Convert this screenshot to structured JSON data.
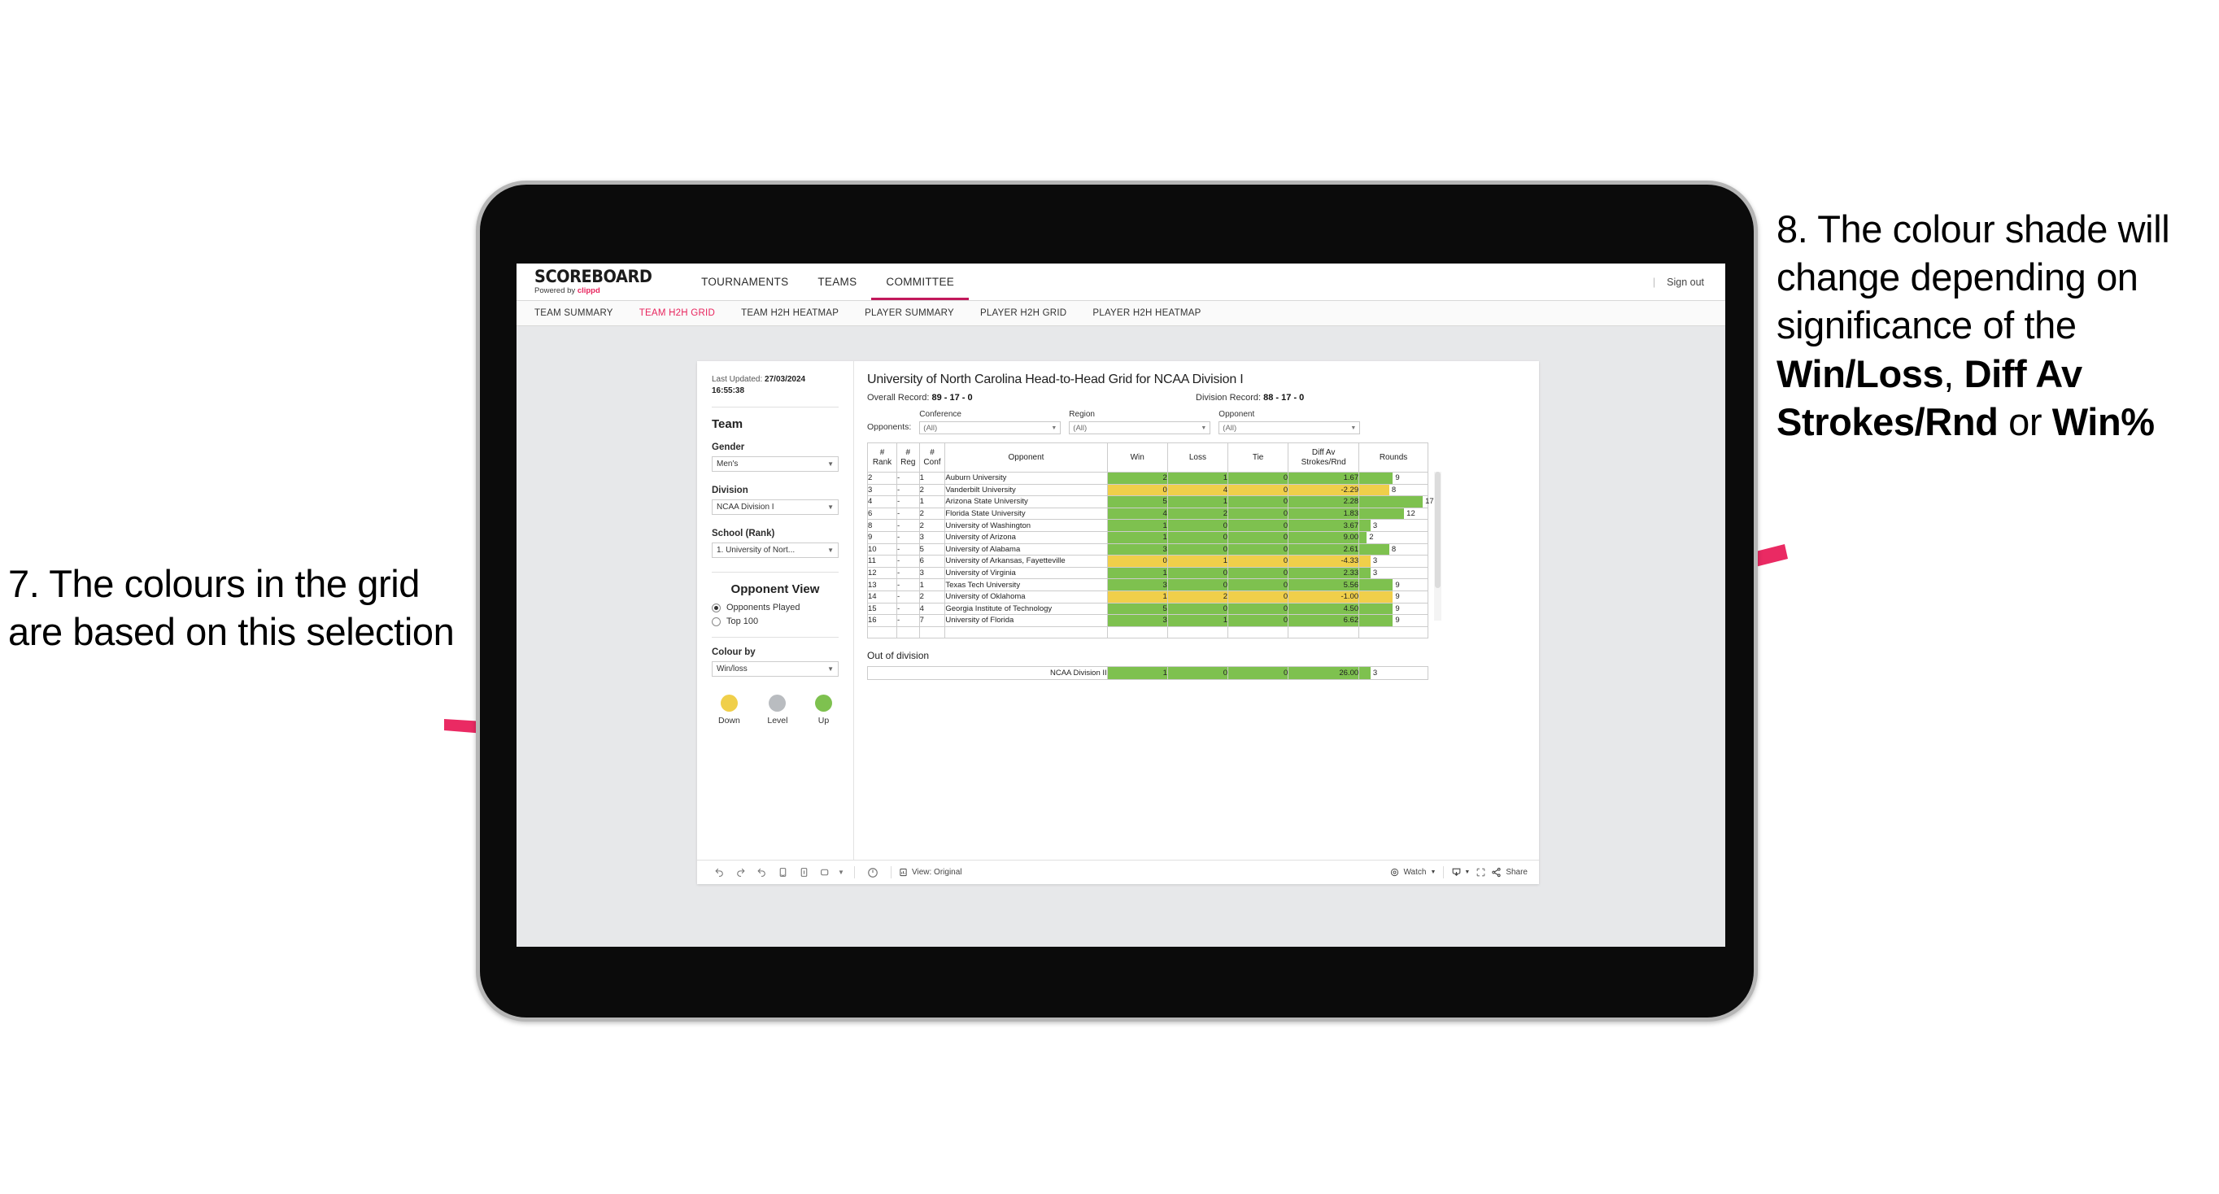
{
  "annotations": {
    "left": "7. The colours in the grid are based on this selection",
    "right_prefix": "8. The colour shade will change depending on significance of the ",
    "right_bold_1": "Win/Loss",
    "right_mid_1": ", ",
    "right_bold_2": "Diff Av Strokes/Rnd",
    "right_mid_2": " or ",
    "right_bold_3": "Win%",
    "arrow_color": "#ea2a63"
  },
  "app": {
    "brand": {
      "title": "SCOREBOARD",
      "powered_prefix": "Powered by ",
      "powered_brand": "clippd"
    },
    "topnav": [
      {
        "label": "TOURNAMENTS",
        "active": false
      },
      {
        "label": "TEAMS",
        "active": false
      },
      {
        "label": "COMMITTEE",
        "active": true
      }
    ],
    "signout": {
      "divider": "|",
      "label": "Sign out"
    },
    "subnav": [
      {
        "label": "TEAM SUMMARY",
        "active": false
      },
      {
        "label": "TEAM H2H GRID",
        "active": true
      },
      {
        "label": "TEAM H2H HEATMAP",
        "active": false
      },
      {
        "label": "PLAYER SUMMARY",
        "active": false
      },
      {
        "label": "PLAYER H2H GRID",
        "active": false
      },
      {
        "label": "PLAYER H2H HEATMAP",
        "active": false
      }
    ]
  },
  "filters": {
    "last_updated_label": "Last Updated: ",
    "last_updated_value": "27/03/2024 16:55:38",
    "team_heading": "Team",
    "gender": {
      "label": "Gender",
      "value": "Men's"
    },
    "division": {
      "label": "Division",
      "value": "NCAA Division I"
    },
    "school": {
      "label": "School (Rank)",
      "value": "1. University of Nort..."
    },
    "opponent_view": {
      "heading": "Opponent View",
      "options": [
        {
          "label": "Opponents Played",
          "selected": true
        },
        {
          "label": "Top 100",
          "selected": false
        }
      ]
    },
    "colour_by": {
      "label": "Colour by",
      "value": "Win/loss"
    },
    "legend": [
      {
        "label": "Down",
        "color": "#f0cf4a"
      },
      {
        "label": "Level",
        "color": "#b9bcc0"
      },
      {
        "label": "Up",
        "color": "#7ec martin"
      }
    ]
  },
  "legend_colors": {
    "down": "#f0cf4a",
    "level": "#b9bcc0",
    "up": "#7ec14f"
  },
  "viz": {
    "title": "University of North Carolina Head-to-Head Grid for NCAA Division I",
    "overall_label": "Overall Record: ",
    "overall_value": "89 - 17 - 0",
    "division_label": "Division Record: ",
    "division_value": "88 - 17 - 0",
    "opponents_label": "Opponents:",
    "opponent_filters": [
      {
        "label": "Conference",
        "value": "(All)"
      },
      {
        "label": "Region",
        "value": "(All)"
      },
      {
        "label": "Opponent",
        "value": "(All)"
      }
    ],
    "out_of_division_title": "Out of division"
  },
  "chart_data": {
    "type": "table",
    "title": "University of North Carolina Head-to-Head Grid for NCAA Division I",
    "columns": [
      "# Rank",
      "# Reg",
      "# Conf",
      "Opponent",
      "Win",
      "Loss",
      "Tie",
      "Diff Av Strokes/Rnd",
      "Rounds"
    ],
    "column_headers_multiline": [
      [
        "#",
        "Rank"
      ],
      [
        "#",
        "Reg"
      ],
      [
        "#",
        "Conf"
      ],
      [
        "Opponent"
      ],
      [
        "Win"
      ],
      [
        "Loss"
      ],
      [
        "Tie"
      ],
      [
        "Diff Av",
        "Strokes/Rnd"
      ],
      [
        "Rounds"
      ]
    ],
    "colour_mode": "Win/loss",
    "rounds_max": 17,
    "rows": [
      {
        "rank": "2",
        "reg": "-",
        "conf": "1",
        "opponent": "Auburn University",
        "win": "2",
        "loss": "1",
        "tie": "0",
        "diff": "1.67",
        "rounds": 9,
        "shade": "up"
      },
      {
        "rank": "3",
        "reg": "-",
        "conf": "2",
        "opponent": "Vanderbilt University",
        "win": "0",
        "loss": "4",
        "tie": "0",
        "diff": "-2.29",
        "rounds": 8,
        "shade": "down"
      },
      {
        "rank": "4",
        "reg": "-",
        "conf": "1",
        "opponent": "Arizona State University",
        "win": "5",
        "loss": "1",
        "tie": "0",
        "diff": "2.28",
        "rounds": 17,
        "shade": "up"
      },
      {
        "rank": "6",
        "reg": "-",
        "conf": "2",
        "opponent": "Florida State University",
        "win": "4",
        "loss": "2",
        "tie": "0",
        "diff": "1.83",
        "rounds": 12,
        "shade": "up"
      },
      {
        "rank": "8",
        "reg": "-",
        "conf": "2",
        "opponent": "University of Washington",
        "win": "1",
        "loss": "0",
        "tie": "0",
        "diff": "3.67",
        "rounds": 3,
        "shade": "up"
      },
      {
        "rank": "9",
        "reg": "-",
        "conf": "3",
        "opponent": "University of Arizona",
        "win": "1",
        "loss": "0",
        "tie": "0",
        "diff": "9.00",
        "rounds": 2,
        "shade": "up"
      },
      {
        "rank": "10",
        "reg": "-",
        "conf": "5",
        "opponent": "University of Alabama",
        "win": "3",
        "loss": "0",
        "tie": "0",
        "diff": "2.61",
        "rounds": 8,
        "shade": "up"
      },
      {
        "rank": "11",
        "reg": "-",
        "conf": "6",
        "opponent": "University of Arkansas, Fayetteville",
        "win": "0",
        "loss": "1",
        "tie": "0",
        "diff": "-4.33",
        "rounds": 3,
        "shade": "down"
      },
      {
        "rank": "12",
        "reg": "-",
        "conf": "3",
        "opponent": "University of Virginia",
        "win": "1",
        "loss": "0",
        "tie": "0",
        "diff": "2.33",
        "rounds": 3,
        "shade": "up"
      },
      {
        "rank": "13",
        "reg": "-",
        "conf": "1",
        "opponent": "Texas Tech University",
        "win": "3",
        "loss": "0",
        "tie": "0",
        "diff": "5.56",
        "rounds": 9,
        "shade": "up"
      },
      {
        "rank": "14",
        "reg": "-",
        "conf": "2",
        "opponent": "University of Oklahoma",
        "win": "1",
        "loss": "2",
        "tie": "0",
        "diff": "-1.00",
        "rounds": 9,
        "shade": "down"
      },
      {
        "rank": "15",
        "reg": "-",
        "conf": "4",
        "opponent": "Georgia Institute of Technology",
        "win": "5",
        "loss": "0",
        "tie": "0",
        "diff": "4.50",
        "rounds": 9,
        "shade": "up"
      },
      {
        "rank": "16",
        "reg": "-",
        "conf": "7",
        "opponent": "University of Florida",
        "win": "3",
        "loss": "1",
        "tie": "0",
        "diff": "6.62",
        "rounds": 9,
        "shade": "up"
      }
    ],
    "out_of_division": [
      {
        "opponent": "NCAA Division II",
        "win": "1",
        "loss": "0",
        "tie": "0",
        "diff": "26.00",
        "rounds": 3,
        "shade": "up"
      }
    ]
  },
  "toolbar": {
    "icons": [
      "undo-icon",
      "redo-icon",
      "revert-icon",
      "refresh-icon",
      "pause-icon",
      "presentation-icon",
      "alerts-icon"
    ],
    "view_label": "View: Original",
    "watch_label": "Watch",
    "share_label": "Share"
  }
}
